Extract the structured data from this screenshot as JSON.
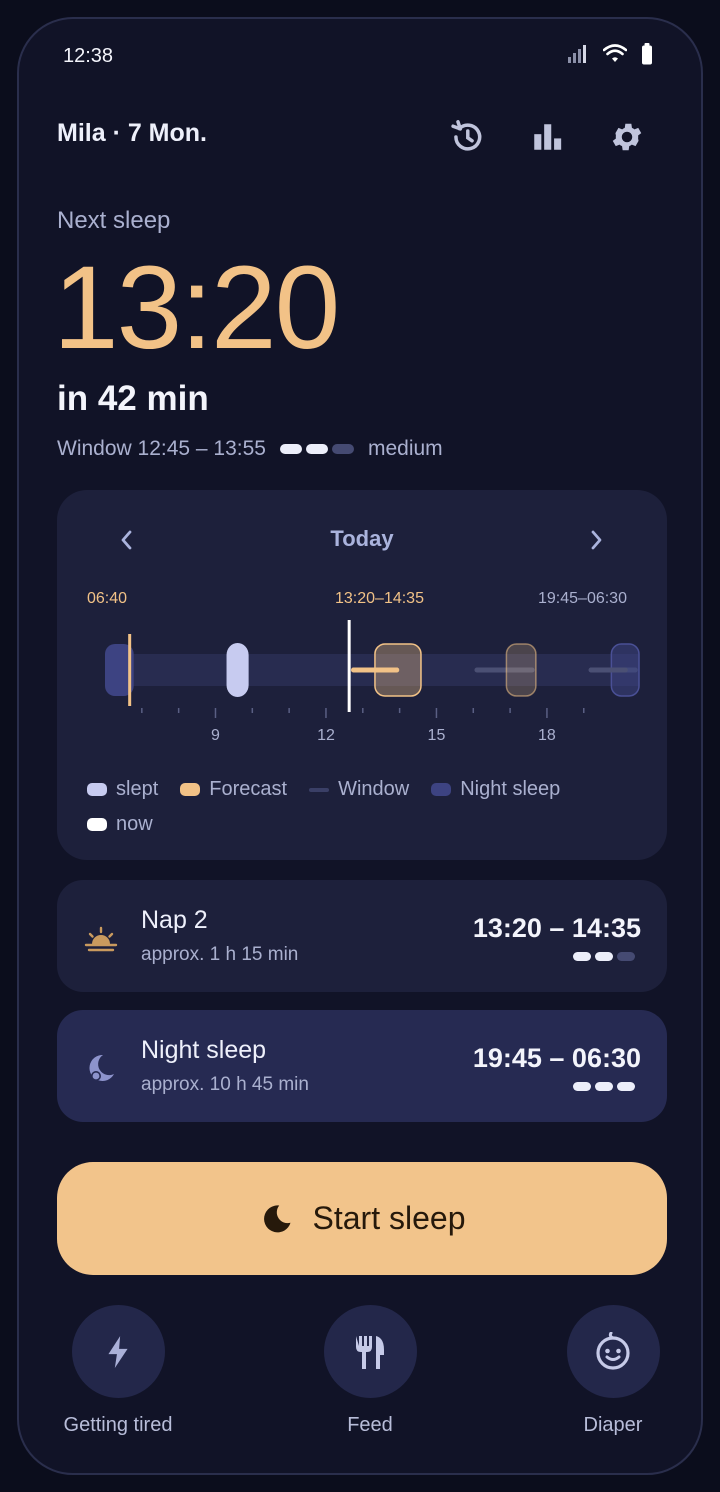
{
  "status_bar": {
    "time": "12:38"
  },
  "header": {
    "title": "Mila · 7 Mon.",
    "buttons": [
      "history-icon",
      "bar-chart-icon",
      "gear-icon"
    ]
  },
  "hero": {
    "label": "Next sleep",
    "time": "13:20",
    "countdown": "in 42 min",
    "window_text": "Window 12:45 – 13:55",
    "confidence_level": 2,
    "confidence_max": 3,
    "confidence_label": "medium"
  },
  "timeline": {
    "title": "Today",
    "top_labels": {
      "wake": "06:40",
      "nap_forecast": "13:20–14:35",
      "night_forecast": "19:45–06:30"
    },
    "axis_ticks": [
      "9",
      "12",
      "15",
      "18"
    ],
    "axis_range_hours": [
      6,
      20.5
    ],
    "now_hour": 12.63,
    "events": {
      "night_end": 6.67,
      "slept_nap": [
        9.3,
        9.9
      ],
      "window_1": [
        12.75,
        13.92
      ],
      "forecast_nap": [
        13.33,
        14.58
      ],
      "window_2": [
        16.1,
        17.6
      ],
      "forecast_2": [
        16.9,
        17.7
      ],
      "window_3": [
        19.2,
        20.4
      ],
      "night_start": [
        19.75,
        20.5
      ]
    },
    "legend": [
      {
        "label": "slept",
        "swatch": "slept"
      },
      {
        "label": "Forecast",
        "swatch": "forecast"
      },
      {
        "label": "Window",
        "swatch": "window"
      },
      {
        "label": "Night sleep",
        "swatch": "night"
      },
      {
        "label": "now",
        "swatch": "now"
      }
    ]
  },
  "cards": [
    {
      "title": "Nap 2",
      "subtitle": "approx. 1 h 15 min",
      "range": "13:20 – 14:35",
      "icon": "sunrise-icon",
      "confidence_level": 2,
      "confidence_max": 3
    },
    {
      "title": "Night sleep",
      "subtitle": "approx. 10 h 45 min",
      "range": "19:45 – 06:30",
      "icon": "moon-icon",
      "confidence_level": 3,
      "confidence_max": 3
    }
  ],
  "start_button": {
    "label": "Start sleep",
    "icon": "moon-icon"
  },
  "actions": [
    {
      "label": "Getting tired",
      "icon": "bolt-icon"
    },
    {
      "label": "Feed",
      "icon": "utensils-icon"
    },
    {
      "label": "Diaper",
      "icon": "baby-face-icon"
    }
  ],
  "colors": {
    "accent": "#f2c287",
    "slept": "#c7cbf0",
    "night": "#3d4382",
    "window": "#3a3f66",
    "now": "#ffffff",
    "card": "#1d203b"
  }
}
